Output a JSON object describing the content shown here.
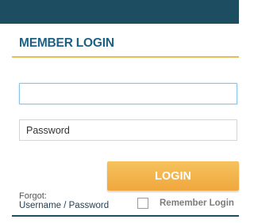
{
  "header": {
    "title": "MEMBER LOGIN"
  },
  "form": {
    "username": {
      "value": "",
      "placeholder": ""
    },
    "password": {
      "value": "",
      "placeholder": "Password"
    },
    "login_label": "LOGIN",
    "forgot_label": "Forgot:",
    "forgot_link": "Username / Password",
    "remember_label": "Remember Login",
    "remember_checked": false
  },
  "colors": {
    "header_bar": "#1d4d61",
    "title_text": "#1c6287",
    "accent_rule": "#e5bd56",
    "button": "#f0a73d"
  }
}
